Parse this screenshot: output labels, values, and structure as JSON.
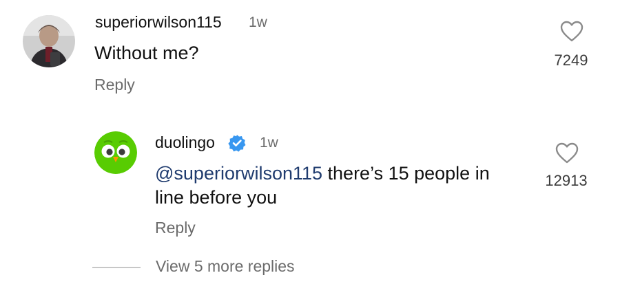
{
  "comment": {
    "username": "superiorwilson115",
    "time": "1w",
    "text": "Without me?",
    "reply_label": "Reply",
    "like_count": "7249"
  },
  "reply": {
    "username": "duolingo",
    "verified": true,
    "time": "1w",
    "mention": "@superiorwilson115",
    "text_line1_rest": " there’s 15 people in",
    "text_line2": "line before you",
    "reply_label": "Reply",
    "like_count": "12913"
  },
  "thread": {
    "view_more_label": "View 5 more replies"
  },
  "colors": {
    "duolingo_green": "#58cc02",
    "verified_blue": "#3897f0",
    "mention_blue": "#1f3b6e",
    "secondary_text": "#6b6b6b"
  },
  "icons": {
    "like": "heart-outline-icon",
    "verified": "verified-badge-icon"
  }
}
